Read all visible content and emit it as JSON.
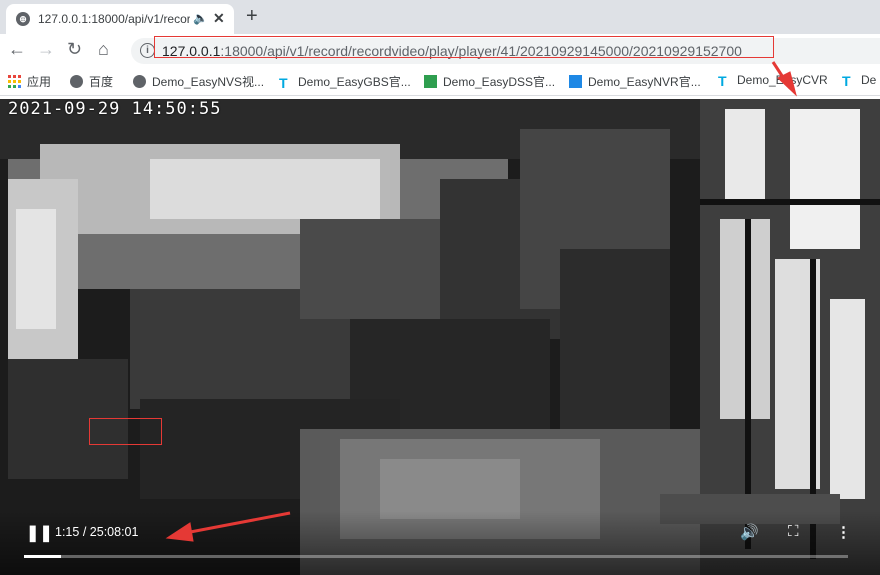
{
  "browser": {
    "tab": {
      "title": "127.0.0.1:18000/api/v1/record/recordvideo/play/player/41/20210929145000/20210929152700",
      "favicon": "globe-icon"
    },
    "address": {
      "host": "127.0.0.1",
      "rest": ":18000/api/v1/record/recordvideo/play/player/41/20210929145000/20210929152700"
    },
    "bookmarks": [
      {
        "label": "应用",
        "icon": "apps-grid-icon",
        "color": "#e8453c"
      },
      {
        "label": "百度",
        "icon": "globe-icon",
        "color": "#5f6368"
      },
      {
        "label": "Demo_EasyNVS视...",
        "icon": "globe-icon",
        "color": "#5f6368"
      },
      {
        "label": "Demo_EasyGBS官...",
        "icon": "easy-t-icon",
        "color": "#00a9e0"
      },
      {
        "label": "Demo_EasyDSS官...",
        "icon": "green-square-icon",
        "color": "#2e9e4f"
      },
      {
        "label": "Demo_EasyNVR官...",
        "icon": "blue-square-icon",
        "color": "#1e88e5"
      },
      {
        "label": "Demo_EasyCVR",
        "icon": "easy-t-icon",
        "color": "#00a9e0"
      },
      {
        "label": "De",
        "icon": "easy-t-icon",
        "color": "#00a9e0"
      }
    ]
  },
  "video": {
    "osd_timestamp": "2021-09-29 14:50:55",
    "current_time": "1:15",
    "separator": "/",
    "duration": "25:08:01",
    "progress_fraction": 0.045
  }
}
